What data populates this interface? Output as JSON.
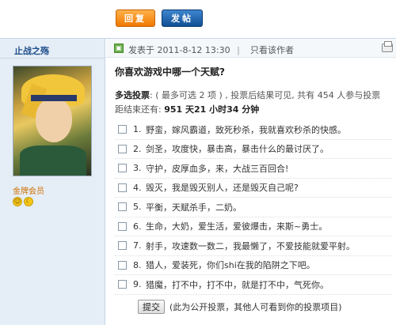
{
  "toolbar": {
    "reply_label": "回复",
    "post_label": "发帖"
  },
  "sidebar": {
    "username": "止战之殇",
    "group": "金牌会员",
    "badges": [
      "☺",
      "☾"
    ]
  },
  "post": {
    "time": "发表于 2011-8-12 13:30",
    "separator": "|",
    "only_author": "只看该作者",
    "title": "你喜欢游戏中哪一个天赋?",
    "poll_type_label": "多选投票",
    "poll_meta": ": ( 最多可选 2 项 ) , 投票后结果可见, 共有 454 人参与投票",
    "countdown_label": "距结束还有: ",
    "countdown_value": "951 天21 小时34 分钟"
  },
  "options": [
    {
      "num": "1.",
      "text": "野蛮，嫁风霸道，致死秒杀，我就喜欢秒杀的快感。"
    },
    {
      "num": "2.",
      "text": "剑圣，攻度快，暴击高，暴击什么的最讨厌了。"
    },
    {
      "num": "3.",
      "text": "守护，皮厚血多，来，大战三百回合!"
    },
    {
      "num": "4.",
      "text": "毁灭，我是毁灭别人，还是毁灭自己呢?"
    },
    {
      "num": "5.",
      "text": "平衡，天赋杀手，二奶。"
    },
    {
      "num": "6.",
      "text": "生命，大奶，爱生活，爱彼爆击，来斯~勇士。"
    },
    {
      "num": "7.",
      "text": "射手，攻速数一数二，我最懒了，不爱技能就爱平射。"
    },
    {
      "num": "8.",
      "text": "猎人，爱装死，你们shi在我的陷阱之下吧。"
    },
    {
      "num": "9.",
      "text": "猎魔，打不中，打不中，就是打不中，气死你。"
    }
  ],
  "submit": {
    "label": "提交",
    "note": "(此为公开投票，其他人可看到你的投票项目)"
  }
}
